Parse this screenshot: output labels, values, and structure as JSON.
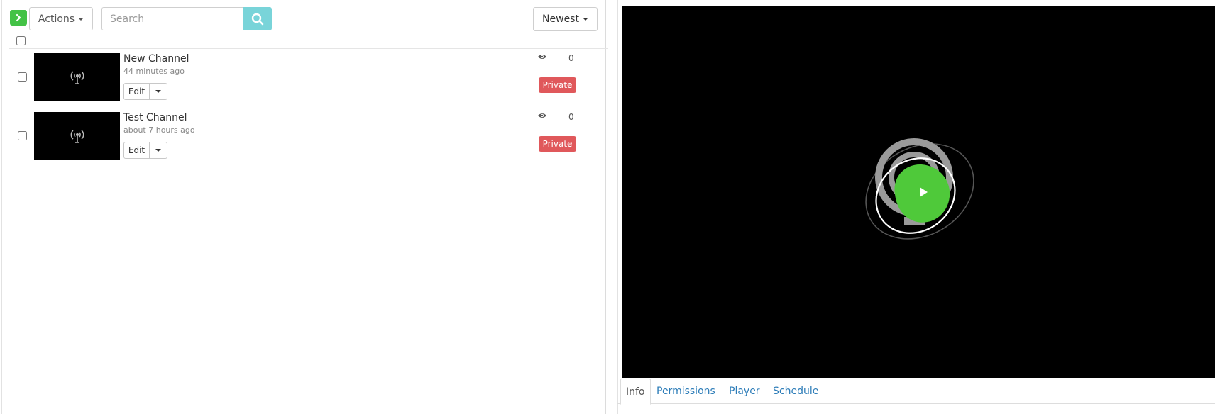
{
  "toolbar": {
    "actions_label": "Actions",
    "search_placeholder": "Search",
    "sort_label": "Newest"
  },
  "channels": [
    {
      "name": "New Channel",
      "time": "44 minutes ago",
      "edit_label": "Edit",
      "views": "0",
      "badge": "Private"
    },
    {
      "name": "Test Channel",
      "time": "about 7 hours ago",
      "edit_label": "Edit",
      "views": "0",
      "badge": "Private"
    }
  ],
  "tabs": [
    {
      "label": "Info",
      "active": true
    },
    {
      "label": "Permissions",
      "active": false
    },
    {
      "label": "Player",
      "active": false
    },
    {
      "label": "Schedule",
      "active": false
    }
  ],
  "colors": {
    "accent_green": "#43c246",
    "search_button": "#79d4d9",
    "private_badge": "#e0585b",
    "link": "#2c7cb8"
  },
  "icons": [
    "chevron-right-icon",
    "search-icon",
    "broadcast-icon",
    "eye-icon",
    "play-icon"
  ]
}
